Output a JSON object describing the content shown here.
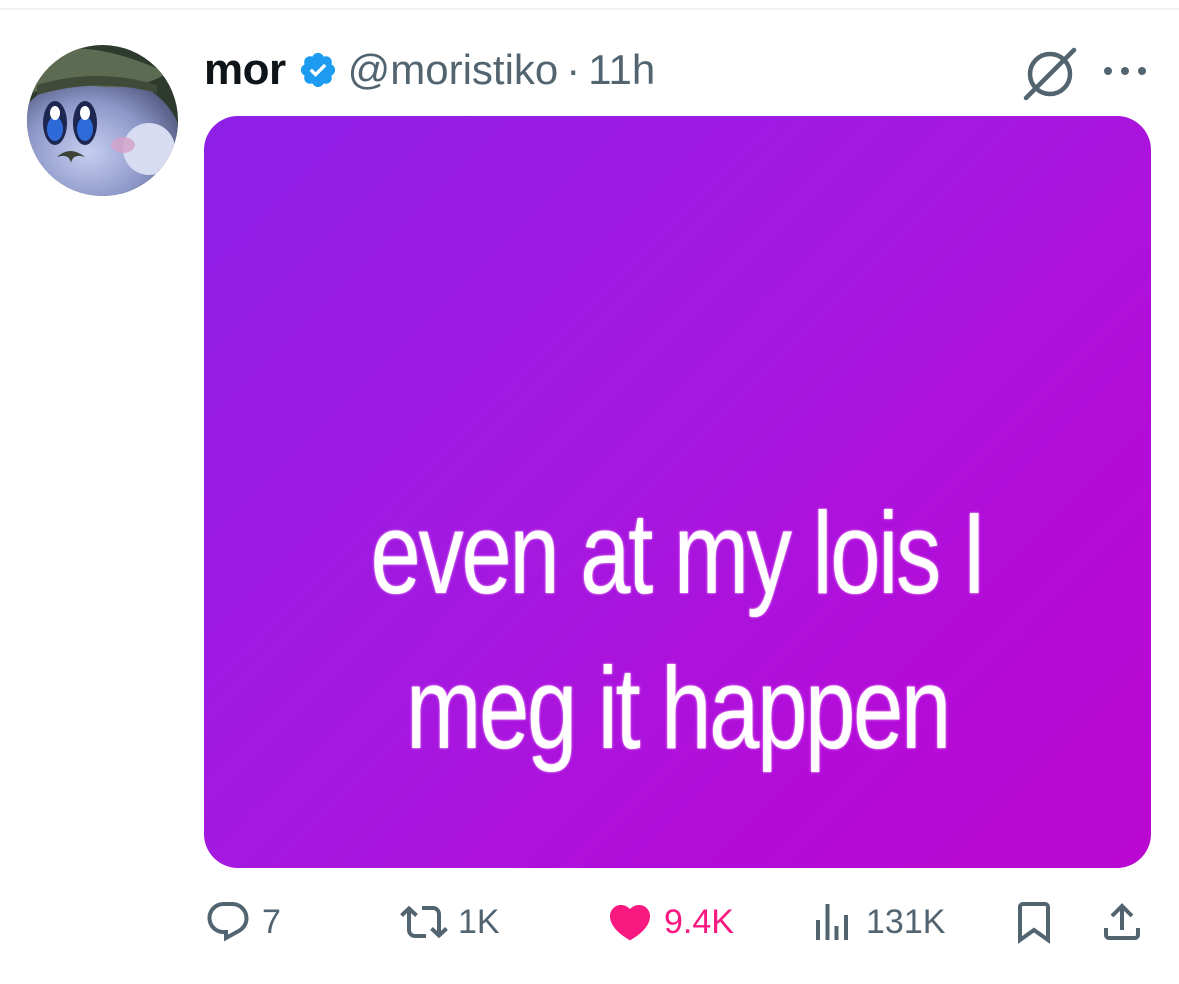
{
  "post": {
    "author": {
      "display_name": "mor",
      "handle": "@moristiko",
      "verified": true,
      "verified_icon": "verified-badge-icon"
    },
    "separator": "·",
    "time": "11h",
    "header_icons": [
      "grok-icon",
      "more-icon"
    ],
    "media": {
      "lines": [
        "even at my lois I",
        "meg it happen"
      ],
      "background_colors": [
        "#8f1fe6",
        "#bb07d2"
      ]
    },
    "actions": {
      "reply": {
        "icon": "reply-icon",
        "count": "7"
      },
      "retweet": {
        "icon": "retweet-icon",
        "count": "1K"
      },
      "like": {
        "icon": "heart-icon",
        "count": "9.4K",
        "liked": true,
        "color": "#f91880"
      },
      "views": {
        "icon": "views-icon",
        "count": "131K"
      },
      "bookmark": {
        "icon": "bookmark-icon"
      },
      "share": {
        "icon": "share-icon"
      }
    }
  },
  "colors": {
    "text_primary": "#0f1419",
    "text_secondary": "#536471",
    "verified_blue": "#1d9bf0"
  }
}
